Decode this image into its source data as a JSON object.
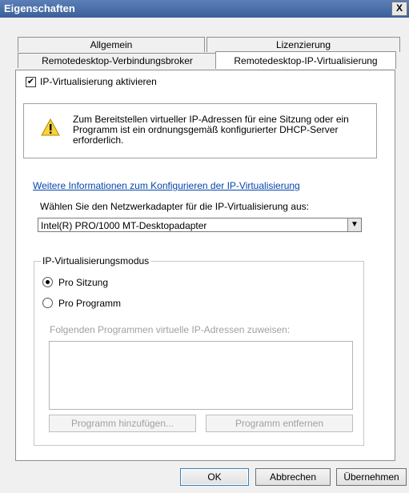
{
  "window": {
    "title": "Eigenschaften",
    "close_glyph": "X"
  },
  "tabs": [
    {
      "label": "Allgemein"
    },
    {
      "label": "Lizenzierung"
    },
    {
      "label": "Remotedesktop-Verbindungsbroker"
    },
    {
      "label": "Remotedesktop-IP-Virtualisierung",
      "selected": true
    }
  ],
  "enable": {
    "label": "IP-Virtualisierung aktivieren",
    "checked": true
  },
  "warning": {
    "icon": "warning-icon",
    "text": "Zum Bereitstellen virtueller IP-Adressen für eine Sitzung oder ein Programm ist ein ordnungsgemäß konfigurierter DHCP-Server erforderlich."
  },
  "info_link": "Weitere Informationen zum Konfigurieren der IP-Virtualisierung",
  "adapter": {
    "prompt": "Wählen Sie den Netzwerkadapter für die IP-Virtualisierung aus:",
    "selected": "Intel(R) PRO/1000 MT-Desktopadapter"
  },
  "mode": {
    "legend": "IP-Virtualisierungsmodus",
    "options": [
      {
        "label": "Pro Sitzung",
        "selected": true
      },
      {
        "label": "Pro Programm",
        "selected": false
      }
    ],
    "programs_label": "Folgenden Programmen virtuelle IP-Adressen zuweisen:",
    "add_button": "Programm hinzufügen...",
    "remove_button": "Programm entfernen"
  },
  "footer": {
    "ok": "OK",
    "cancel": "Abbrechen",
    "apply": "Übernehmen"
  }
}
